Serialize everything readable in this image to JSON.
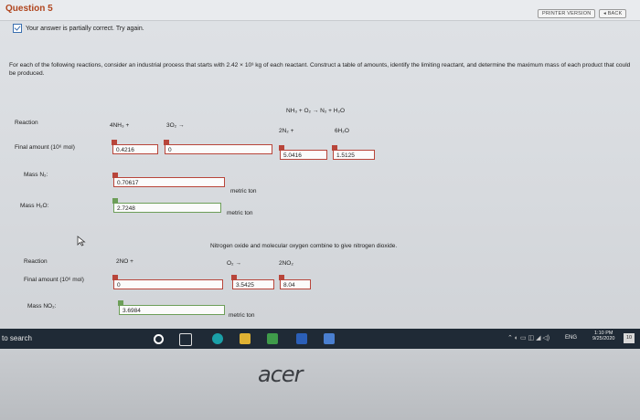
{
  "header": {
    "question": "Question 5",
    "printer_version": "PRINTER VERSION",
    "back": "◂ BACK"
  },
  "feedback": {
    "text": "Your answer is partially correct.  Try again."
  },
  "problem": {
    "text": "For each of the following reactions, consider an industrial process that starts with 2.42 × 10³ kg of each reactant. Construct a table of amounts, identify the limiting reactant, and determine the maximum mass of each product that could be produced."
  },
  "reaction1": {
    "equation": "NH₃ + O₂ → N₂ + H₂O",
    "reaction_label": "Reaction",
    "terms": [
      "4NH₃ +",
      "3O₂ →",
      "2N₂ +",
      "6H₂O"
    ],
    "final_amount_label": "Final amount (10⁶ mol)",
    "final_amounts": [
      "0.4216",
      "0",
      "5.0416",
      "1.5125"
    ],
    "mass_n2_label": "Mass N₂:",
    "mass_n2": "0.70617",
    "mass_h2o_label": "Mass H₂O:",
    "mass_h2o": "2.7248",
    "unit": "metric ton"
  },
  "reaction2": {
    "description": "Nitrogen oxide and molecular oxygen combine to give nitrogen dioxide.",
    "reaction_label": "Reaction",
    "terms": [
      "2NO +",
      "O₂ →",
      "2NO₂"
    ],
    "final_amount_label": "Final amount (10⁶ mol)",
    "final_amounts": [
      "0",
      "3.5425",
      "8.04"
    ],
    "mass_no2_label": "Mass NO₂:",
    "mass_no2": "3.6984",
    "unit": "metric ton"
  },
  "taskbar": {
    "search": "to search",
    "lang": "ENG",
    "time": "1:10 PM",
    "date": "9/25/2020",
    "notif": "10"
  },
  "bezel": {
    "brand": "acer"
  }
}
